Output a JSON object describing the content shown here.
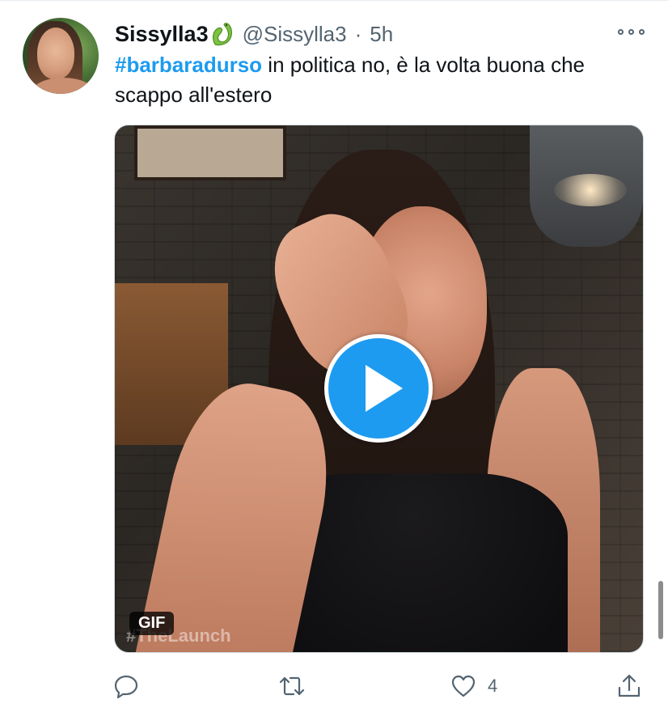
{
  "tweet": {
    "display_name": "Sissylla3",
    "handle": "@Sissylla3",
    "separator": "·",
    "time": "5h",
    "hashtag": "#barbaradurso",
    "text_rest": " in politica no, è la volta buona che scappo all'estero",
    "media": {
      "badge": "GIF",
      "watermark": "#TheLaunch"
    },
    "actions": {
      "reply_icon": "reply-icon",
      "retweet_icon": "retweet-icon",
      "like_icon": "heart-icon",
      "like_count": "4",
      "share_icon": "share-icon"
    }
  },
  "icons": {
    "verified_emoji": "snake-icon",
    "more": "more-icon",
    "play": "play-icon"
  },
  "colors": {
    "accent": "#1d9bf0",
    "text": "#0f1419",
    "secondary": "#536471"
  }
}
